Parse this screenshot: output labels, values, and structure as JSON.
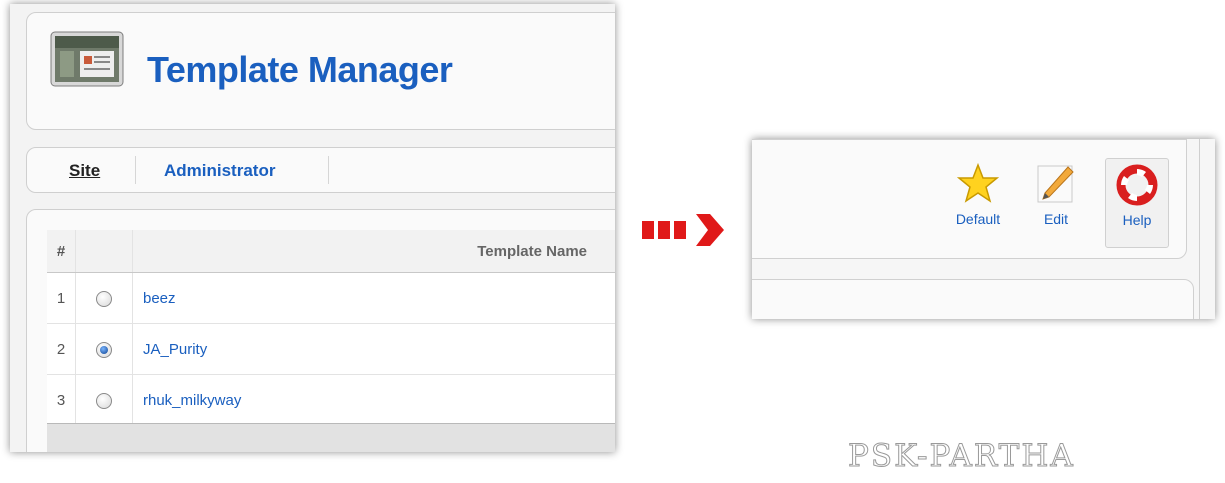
{
  "header": {
    "title": "Template Manager",
    "icon": "template-manager-icon"
  },
  "tabs": [
    {
      "label": "Site",
      "active": true
    },
    {
      "label": "Administrator",
      "active": false
    }
  ],
  "table": {
    "columns": [
      "#",
      "",
      "Template Name"
    ],
    "rows": [
      {
        "num": "1",
        "name": "beez",
        "selected": false
      },
      {
        "num": "2",
        "name": "JA_Purity",
        "selected": true
      },
      {
        "num": "3",
        "name": "rhuk_milkyway",
        "selected": false
      }
    ]
  },
  "toolbar": {
    "default_label": "Default",
    "edit_label": "Edit",
    "help_label": "Help",
    "icons": [
      "star-icon",
      "pencil-icon",
      "lifebuoy-icon"
    ]
  },
  "watermark": "PSK-PARTHA",
  "colors": {
    "link": "#1a5fbf",
    "arrow": "#e01919"
  }
}
